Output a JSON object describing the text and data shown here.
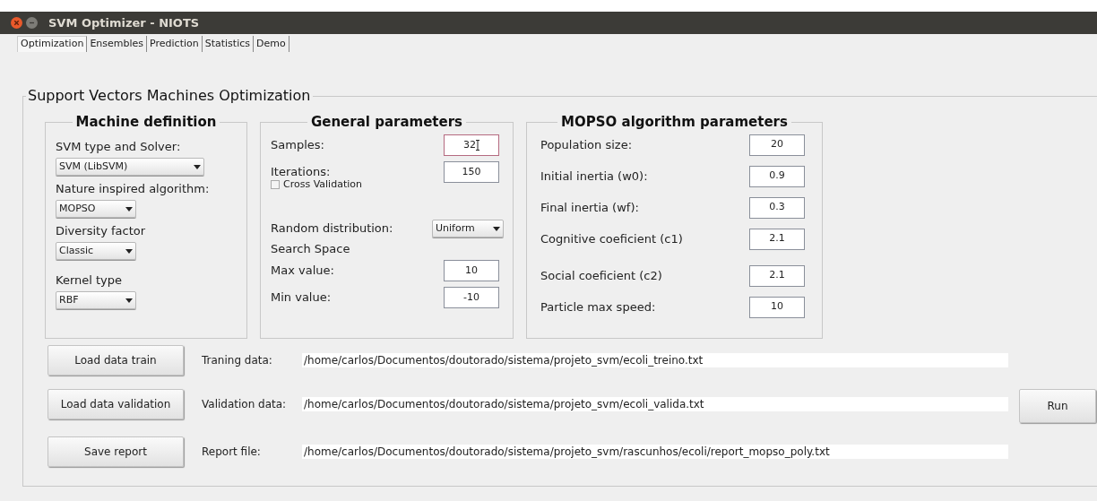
{
  "window": {
    "title": "SVM Optimizer - NIOTS"
  },
  "tabs": [
    {
      "label": "Optimization",
      "selected": true
    },
    {
      "label": "Ensembles",
      "selected": false
    },
    {
      "label": "Prediction",
      "selected": false
    },
    {
      "label": "Statistics",
      "selected": false
    },
    {
      "label": "Demo",
      "selected": false
    }
  ],
  "group_title": "Support Vectors Machines Optimization",
  "machine_definition": {
    "title": "Machine definition",
    "fields": [
      {
        "label": "SVM type and Solver:",
        "value": "SVM (LibSVM)",
        "wide": true
      },
      {
        "label": "Nature inspired algorithm:",
        "value": "MOPSO",
        "wide": false
      },
      {
        "label": "Diversity factor",
        "value": "Classic",
        "wide": false
      },
      {
        "label": "Kernel type",
        "value": "RBF",
        "wide": false
      }
    ]
  },
  "general_parameters": {
    "title": "General parameters",
    "items": [
      {
        "kind": "field",
        "label": "Samples:",
        "value": "32",
        "focused": true
      },
      {
        "kind": "field",
        "label": "Iterations:",
        "value": "150",
        "focused": false
      },
      {
        "kind": "checkbox",
        "label": "Cross Validation",
        "checked": false
      },
      {
        "kind": "select",
        "label": "Random distribution:",
        "value": "Uniform"
      },
      {
        "kind": "heading",
        "label": "Search Space"
      },
      {
        "kind": "field",
        "label": "Max value:",
        "value": "10",
        "focused": false
      },
      {
        "kind": "field",
        "label": "Min value:",
        "value": "-10",
        "focused": false
      }
    ]
  },
  "mopso_parameters": {
    "title": "MOPSO algorithm parameters",
    "fields": [
      {
        "label": "Population size:",
        "value": "20"
      },
      {
        "label": "Initial inertia (w0):",
        "value": "0.9"
      },
      {
        "label": "Final inertia (wf):",
        "value": "0.3"
      },
      {
        "label": "Cognitive coeficient (c1)",
        "value": "2.1"
      },
      {
        "label": "Social coeficient (c2)",
        "value": "2.1"
      },
      {
        "label": "Particle max speed:",
        "value": "10"
      }
    ]
  },
  "files": [
    {
      "button": "Load data train",
      "label": "Traning data:",
      "path": "/home/carlos/Documentos/doutorado/sistema/projeto_svm/ecoli_treino.txt"
    },
    {
      "button": "Load data validation",
      "label": "Validation data:",
      "path": "/home/carlos/Documentos/doutorado/sistema/projeto_svm/ecoli_valida.txt"
    },
    {
      "button": "Save report",
      "label": "Report file:",
      "path": "/home/carlos/Documentos/doutorado/sistema/projeto_svm/rascunhos/ecoli/report_mopso_poly.txt"
    }
  ],
  "run_button": "Run"
}
